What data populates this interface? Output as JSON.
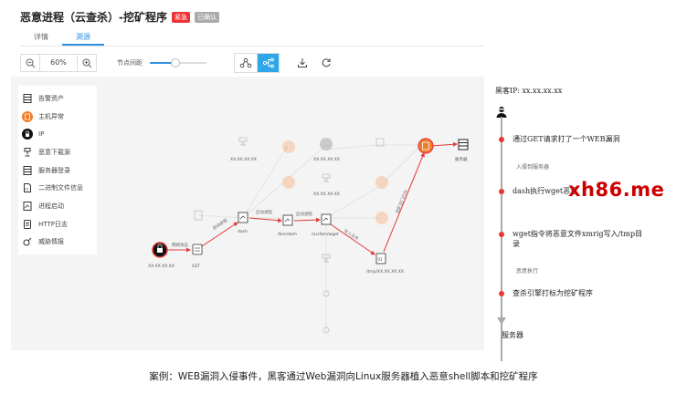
{
  "page": {
    "title": "恶意进程（云查杀）-挖矿程序",
    "badge_urgent": "紧急",
    "badge_confirmed": "已确认",
    "tabs": [
      {
        "label": "详情"
      },
      {
        "label": "溯源"
      }
    ],
    "active_tab": 1
  },
  "toolbar": {
    "zoom": "60%",
    "spacing_label": "节点间距",
    "spacing_value": 0.45
  },
  "legend": [
    {
      "label": "告警资产",
      "icon": "server-icon"
    },
    {
      "label": "主机异常",
      "icon": "host-alert-icon"
    },
    {
      "label": "IP",
      "icon": "hacker-ip-icon"
    },
    {
      "label": "恶意下载源",
      "icon": "download-icon"
    },
    {
      "label": "服务器登录",
      "icon": "server-login-icon"
    },
    {
      "label": "二进制文件信息",
      "icon": "binary-file-icon"
    },
    {
      "label": "进程启动",
      "icon": "process-icon"
    },
    {
      "label": "HTTP日志",
      "icon": "http-log-icon"
    },
    {
      "label": "威胁情报",
      "icon": "intel-icon"
    }
  ],
  "graph": {
    "ip_label": "XX.XX.XX.XX",
    "get_label": "GET",
    "dash_label": "dash",
    "bindash_label": "/bin/dash",
    "wget_label": "/usr/bin/wget",
    "xmrig_label": "/tmp/",
    "xmrig_label_ip": "XX.XX.XX.XX",
    "top_ip_label": "XX.XX.XX.XX",
    "mid_ip_label": "XX.XX.XX.XX",
    "low_ip_label": "XX.XX.XX.XX",
    "server_label": "服务器",
    "edge_attack": "网络攻击",
    "edge_launch": "启动进程",
    "edge_launch2": "启动进程",
    "edge_launch3": "启动进程",
    "edge_write": "写入文件",
    "edge_mining": "挖矿后门行为"
  },
  "timeline": {
    "header": "黑客IP: xx.xx.xx.xx",
    "events": [
      {
        "text": "通过GET请求打了一个WEB漏洞"
      },
      {
        "text": "dash执行wget恶意"
      },
      {
        "text": "wget指令将恶意文件xmrig写入/tmp目录"
      },
      {
        "text": "查杀引擎打标为挖矿程序"
      }
    ],
    "stages": [
      "入侵到服务器",
      "恶意执行"
    ],
    "footer": "服务器"
  },
  "watermark": "xh86.me",
  "caption": "案例：WEB漏洞入侵事件，黑客通过Web漏洞向Linux服务器植入恶意shell脚本和挖矿程序",
  "colors": {
    "accent": "#2f8fe0",
    "attack": "#e33b3b",
    "alert_orange": "#f07c2a"
  }
}
